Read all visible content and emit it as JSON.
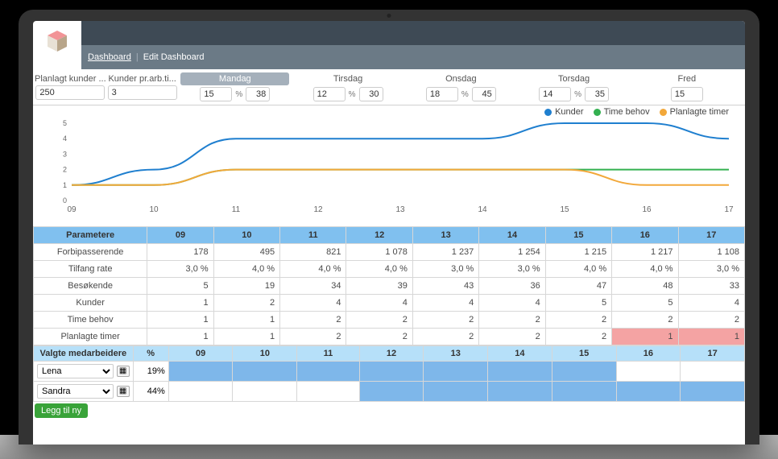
{
  "nav": {
    "tab1": "Dashboard",
    "tab2": "Edit Dashboard"
  },
  "filters": {
    "planned_customers_label": "Planlagt kunder ...",
    "planned_customers_value": "250",
    "customers_per_hour_label": "Kunder pr.arb.ti...",
    "customers_per_hour_value": "3"
  },
  "days": [
    {
      "label": "Mandag",
      "v1": "15",
      "v2": "38",
      "selected": true
    },
    {
      "label": "Tirsdag",
      "v1": "12",
      "v2": "30"
    },
    {
      "label": "Onsdag",
      "v1": "18",
      "v2": "45"
    },
    {
      "label": "Torsdag",
      "v1": "14",
      "v2": "35"
    },
    {
      "label": "Fred",
      "v1": "15",
      "v2": ""
    }
  ],
  "legend": {
    "kunder": "Kunder",
    "time_behov": "Time behov",
    "planlagte": "Planlagte timer"
  },
  "chart_data": {
    "type": "line",
    "x": [
      "09",
      "10",
      "11",
      "12",
      "13",
      "14",
      "15",
      "16",
      "17"
    ],
    "ylim": [
      0,
      5
    ],
    "yticks": [
      0,
      1,
      2,
      3,
      4,
      5
    ],
    "series": [
      {
        "name": "Kunder",
        "color": "#1f7fcf",
        "values": [
          1,
          2,
          4,
          4,
          4,
          4,
          5,
          5,
          4
        ]
      },
      {
        "name": "Time behov",
        "color": "#33b050",
        "values": [
          1,
          1,
          2,
          2,
          2,
          2,
          2,
          2,
          2
        ]
      },
      {
        "name": "Planlagte timer",
        "color": "#f2a83a",
        "values": [
          1,
          1,
          2,
          2,
          2,
          2,
          2,
          1,
          1
        ]
      }
    ]
  },
  "params_header": {
    "param": "Parametere",
    "hours": [
      "09",
      "10",
      "11",
      "12",
      "13",
      "14",
      "15",
      "16",
      "17"
    ]
  },
  "params": [
    {
      "name": "Forbipasserende",
      "vals": [
        "178",
        "495",
        "821",
        "1 078",
        "1 237",
        "1 254",
        "1 215",
        "1 217",
        "1 108"
      ]
    },
    {
      "name": "Tilfang rate",
      "vals": [
        "3,0 %",
        "4,0 %",
        "4,0 %",
        "4,0 %",
        "3,0 %",
        "3,0 %",
        "4,0 %",
        "4,0 %",
        "3,0 %"
      ]
    },
    {
      "name": "Besøkende",
      "vals": [
        "5",
        "19",
        "34",
        "39",
        "43",
        "36",
        "47",
        "48",
        "33"
      ]
    },
    {
      "name": "Kunder",
      "vals": [
        "1",
        "2",
        "4",
        "4",
        "4",
        "4",
        "5",
        "5",
        "4"
      ]
    },
    {
      "name": "Time behov",
      "vals": [
        "1",
        "1",
        "2",
        "2",
        "2",
        "2",
        "2",
        "2",
        "2"
      ]
    },
    {
      "name": "Planlagte timer",
      "vals": [
        "1",
        "1",
        "2",
        "2",
        "2",
        "2",
        "2",
        "1",
        "1"
      ],
      "warn": [
        7,
        8
      ]
    }
  ],
  "staff_header": {
    "label": "Valgte medarbeidere",
    "pct": "%",
    "hours": [
      "09",
      "10",
      "11",
      "12",
      "13",
      "14",
      "15",
      "16",
      "17"
    ]
  },
  "staff": [
    {
      "name": "Lena",
      "pct": "19%",
      "start": 0,
      "end": 7
    },
    {
      "name": "Sandra",
      "pct": "44%",
      "start": 3,
      "end": 9
    }
  ],
  "add_button": "Legg til ny",
  "pct_symbol": "%"
}
